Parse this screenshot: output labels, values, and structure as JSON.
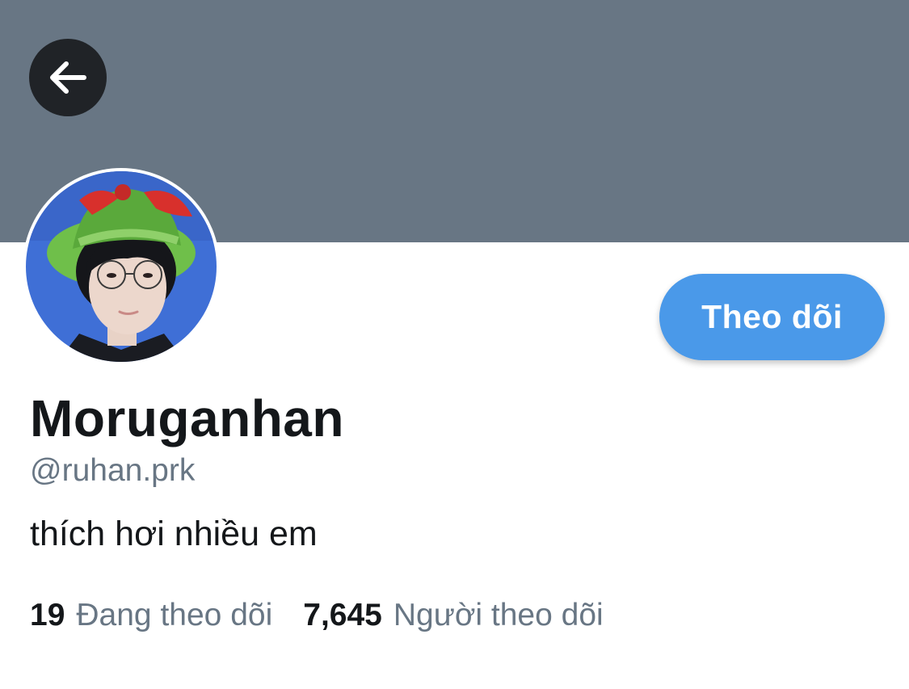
{
  "profile": {
    "display_name": "Moruganhan",
    "handle": "@ruhan.prk",
    "bio": "thích hơi nhiều em",
    "follow_button_label": "Theo dõi",
    "following_count": "19",
    "following_label": "Đang theo dõi",
    "followers_count": "7,645",
    "followers_label": "Người theo dõi"
  },
  "icons": {
    "back": "arrow-left-icon",
    "avatar": "profile-photo"
  },
  "colors": {
    "banner": "#687684",
    "accent": "#4a99e9",
    "text_primary": "#14171a",
    "text_secondary": "#687684",
    "back_button_bg": "#202327"
  }
}
